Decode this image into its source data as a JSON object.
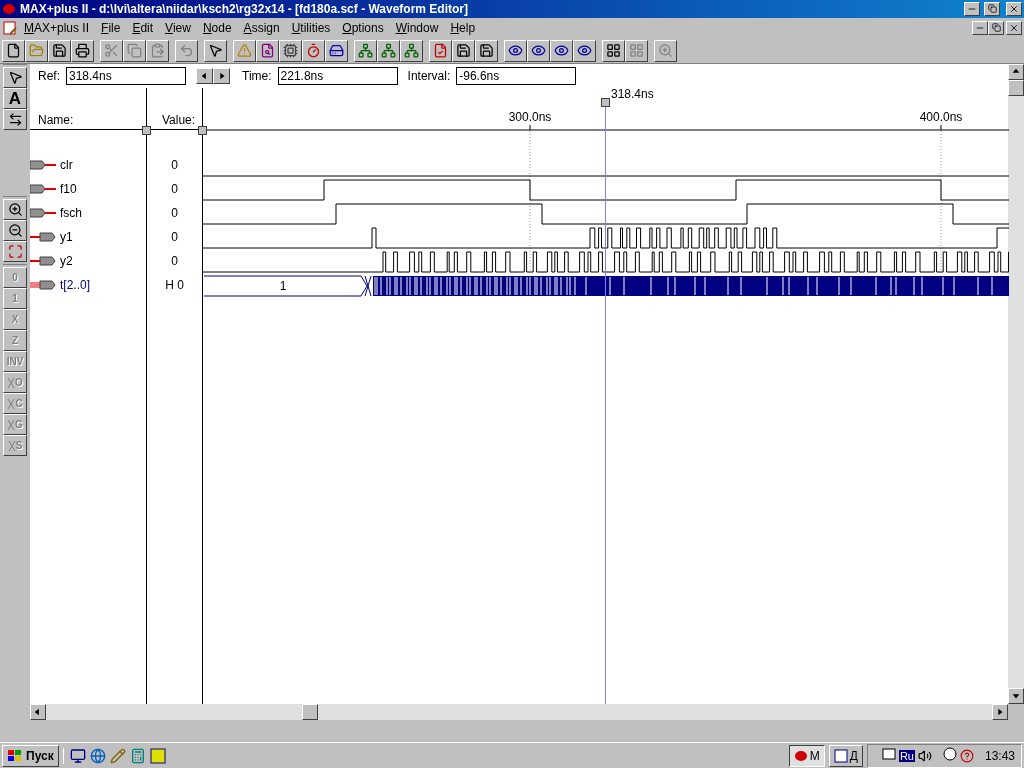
{
  "window": {
    "title": "MAX+plus II - d:\\lvi\\altera\\niidar\\ksch2\\rg32x14 - [fd180a.scf - Waveform Editor]"
  },
  "menu": [
    {
      "label": "MAX+plus II"
    },
    {
      "label": "File"
    },
    {
      "label": "Edit"
    },
    {
      "label": "View"
    },
    {
      "label": "Node"
    },
    {
      "label": "Assign"
    },
    {
      "label": "Utilities"
    },
    {
      "label": "Options"
    },
    {
      "label": "Window"
    },
    {
      "label": "Help"
    }
  ],
  "toolbar": [
    [
      {
        "kind": "new-file",
        "disabled": false
      },
      {
        "kind": "folder",
        "disabled": false
      },
      {
        "kind": "floppy",
        "disabled": false
      },
      {
        "kind": "printer",
        "disabled": false
      }
    ],
    [
      {
        "kind": "scissors",
        "disabled": true
      },
      {
        "kind": "copy",
        "disabled": true
      },
      {
        "kind": "clipboard",
        "disabled": true
      }
    ],
    [
      {
        "kind": "undo",
        "disabled": true
      }
    ],
    [
      {
        "kind": "pointer",
        "disabled": false
      }
    ],
    [
      {
        "kind": "warning",
        "disabled": false
      },
      {
        "kind": "file-search",
        "disabled": false
      },
      {
        "kind": "chip",
        "disabled": false
      },
      {
        "kind": "timer",
        "disabled": false
      },
      {
        "kind": "drive",
        "disabled": false
      }
    ],
    [
      {
        "kind": "hierarchy",
        "disabled": false
      },
      {
        "kind": "hierarchy",
        "disabled": false
      },
      {
        "kind": "hierarchy",
        "disabled": false
      }
    ],
    [
      {
        "kind": "file-check",
        "disabled": false
      },
      {
        "kind": "floppy",
        "disabled": false
      },
      {
        "kind": "floppy",
        "disabled": false
      }
    ],
    [
      {
        "kind": "eye",
        "disabled": false
      },
      {
        "kind": "eye",
        "disabled": false
      },
      {
        "kind": "eye",
        "disabled": false
      },
      {
        "kind": "eye",
        "disabled": false
      }
    ],
    [
      {
        "kind": "grid",
        "disabled": false
      },
      {
        "kind": "grid",
        "disabled": true
      }
    ],
    [
      {
        "kind": "zoom",
        "disabled": true
      }
    ]
  ],
  "left_toolbar": [
    [
      {
        "kind": "pointer",
        "disabled": false
      },
      {
        "kind": "letter",
        "label": "A",
        "disabled": false
      },
      {
        "kind": "swap",
        "disabled": false
      }
    ],
    [
      {
        "kind": "zoom-in",
        "disabled": false
      },
      {
        "kind": "zoom-out",
        "disabled": false
      },
      {
        "kind": "fit",
        "disabled": false
      }
    ],
    [
      {
        "kind": "letter",
        "label": "0",
        "disabled": true
      },
      {
        "kind": "letter",
        "label": "1",
        "disabled": true
      },
      {
        "kind": "letter",
        "label": "X",
        "disabled": true
      },
      {
        "kind": "letter",
        "label": "Z",
        "disabled": true
      },
      {
        "kind": "letter",
        "label": "INV",
        "disabled": true
      },
      {
        "kind": "bus-letter",
        "label": "O",
        "disabled": true
      },
      {
        "kind": "bus-letter",
        "label": "C",
        "disabled": true
      },
      {
        "kind": "bus-letter",
        "label": "G",
        "disabled": true
      },
      {
        "kind": "bus-letter",
        "label": "S",
        "disabled": true
      }
    ]
  ],
  "ref_bar": {
    "ref_label": "Ref:",
    "ref": "318.4ns",
    "time_label": "Time:",
    "time": "221.8ns",
    "interval_label": "Interval:",
    "interval": "-96.6ns"
  },
  "columns": {
    "name": "Name:",
    "value": "Value:"
  },
  "timeline": {
    "cursor": "318.4ns",
    "marks": [
      "300.0ns",
      "400.0ns"
    ]
  },
  "signals": [
    {
      "name": "clr",
      "kind": "input",
      "value": "0"
    },
    {
      "name": "f10",
      "kind": "input",
      "value": "0"
    },
    {
      "name": "fsch",
      "kind": "input",
      "value": "0"
    },
    {
      "name": "y1",
      "kind": "output",
      "value": "0"
    },
    {
      "name": "y2",
      "kind": "output",
      "value": "0"
    },
    {
      "name": "t[2..0]",
      "kind": "bus",
      "value": "H 0",
      "bus_value": "1"
    }
  ],
  "taskbar": {
    "start": "Пуск",
    "tasks": [
      {
        "label": "M",
        "selected": true
      },
      {
        "label": "Д",
        "selected": false
      }
    ],
    "language": "Ru",
    "clock": "13:43"
  }
}
